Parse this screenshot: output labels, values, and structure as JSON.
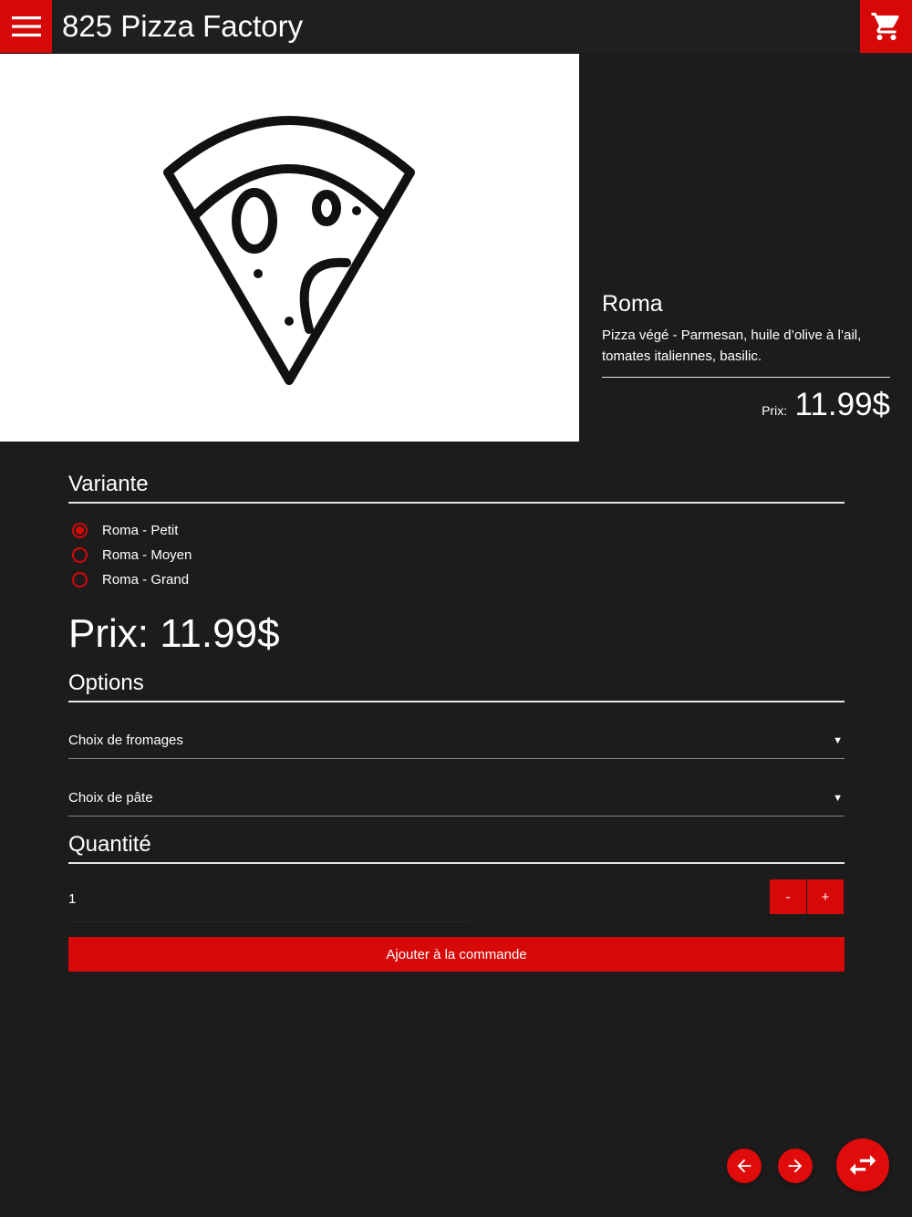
{
  "app": {
    "title": "825 Pizza Factory"
  },
  "icons": {
    "menu": "hamburger-menu-icon",
    "cart": "shopping-cart-icon",
    "hero": "pizza-slice-icon",
    "prev": "arrow-left-icon",
    "next": "arrow-right-icon",
    "swap": "swap-horizontal-icon"
  },
  "colors": {
    "accent": "#d60808",
    "background": "#1c1c1d",
    "topbar": "#1f1f20",
    "text": "#ffffff"
  },
  "product": {
    "name": "Roma",
    "description": "Pizza végé - Parmesan, huile d’olive à l’ail, tomates italiennes, basilic.",
    "price_label": "Prix:",
    "price_value": "11.99$"
  },
  "variant": {
    "title": "Variante",
    "options": [
      {
        "label": "Roma - Petit",
        "selected": true
      },
      {
        "label": "Roma - Moyen",
        "selected": false
      },
      {
        "label": "Roma - Grand",
        "selected": false
      }
    ]
  },
  "price_display": "Prix: 11.99$",
  "options": {
    "title": "Options",
    "selects": [
      {
        "label": "Choix de fromages",
        "arrow": "▼"
      },
      {
        "label": "Choix de pâte",
        "arrow": "▼"
      }
    ]
  },
  "quantity": {
    "title": "Quantité",
    "value": "1",
    "minus": "-",
    "plus": "+"
  },
  "add_button": "Ajouter à la commande"
}
